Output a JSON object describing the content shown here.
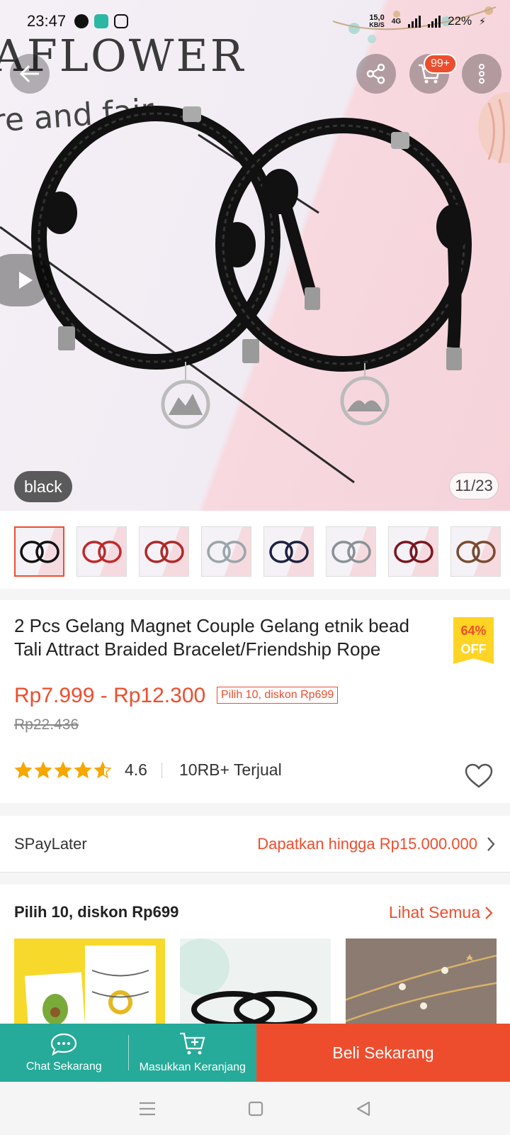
{
  "status_bar": {
    "time": "23:47",
    "net_speed_value": "15,0",
    "net_speed_unit": "KB/S",
    "network": "4G",
    "battery": "22%"
  },
  "hero": {
    "watermark_line1": "AFLOWER",
    "watermark_line2": "re and fair",
    "variant": "black",
    "counter": "11/23",
    "cart_badge": "99+"
  },
  "thumbnails": [
    {
      "name": "black",
      "color": "#111111",
      "selected": true
    },
    {
      "name": "red",
      "color": "#c0282b",
      "selected": false
    },
    {
      "name": "red-black",
      "color": "#b02828",
      "selected": false
    },
    {
      "name": "white",
      "color": "#9aa4aa",
      "selected": false
    },
    {
      "name": "navy",
      "color": "#1d2240",
      "selected": false
    },
    {
      "name": "grey",
      "color": "#8a9196",
      "selected": false
    },
    {
      "name": "burgundy",
      "color": "#7a1620",
      "selected": false
    },
    {
      "name": "brown",
      "color": "#7a4a30",
      "selected": false
    }
  ],
  "product": {
    "title": "2 Pcs Gelang Magnet Couple Gelang etnik bead Tali Attract Braided Bracelet/Friendship Rope",
    "discount_line1": "64%",
    "discount_line2": "OFF",
    "price_range": "Rp7.999 - Rp12.300",
    "promo": "Pilih 10, diskon Rp699",
    "original_price": "Rp22.436",
    "rating": "4.6",
    "rating_value": 4.6,
    "sold": "10RB+ Terjual"
  },
  "spaylater": {
    "label": "SPayLater",
    "value": "Dapatkan hingga Rp15.000.000"
  },
  "bundle": {
    "title": "Pilih 10, diskon Rp699",
    "link": "Lihat Semua"
  },
  "actions": {
    "chat": "Chat Sekarang",
    "cart": "Masukkan Keranjang",
    "buy": "Beli Sekarang"
  },
  "colors": {
    "accent": "#ee4d2d",
    "teal": "#26aa99",
    "badge_yellow": "#ffd424"
  }
}
